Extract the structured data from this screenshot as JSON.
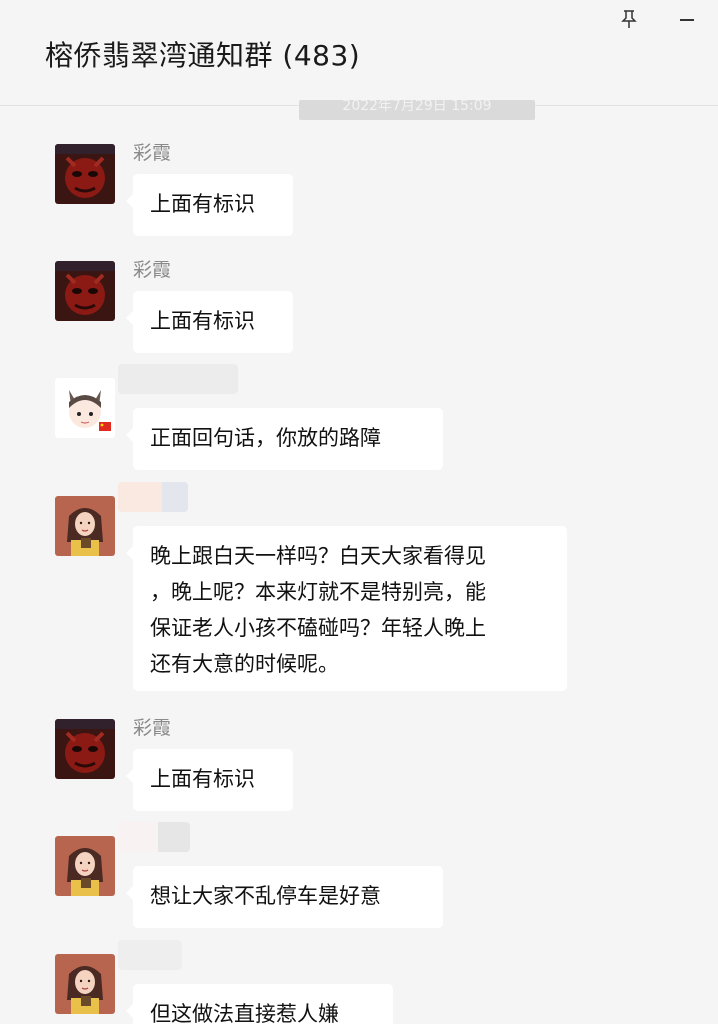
{
  "window": {
    "title": "榕侨翡翠湾通知群 (483)"
  },
  "timestamp": "2022年7月29日 15:09",
  "messages": [
    {
      "sender": "彩霞",
      "avatar": "red-mask-avatar",
      "text": "上面有标识"
    },
    {
      "sender": "彩霞",
      "avatar": "red-mask-avatar",
      "text": "上面有标识"
    },
    {
      "sender": "",
      "avatar": "cartoon-cat-avatar",
      "text": "正面回句话，你放的路障"
    },
    {
      "sender": "",
      "avatar": "woman-portrait-avatar",
      "text_lines": [
        "晚上跟白天一样吗？白天大家看得见",
        "，晚上呢？本来灯就不是特别亮，能",
        "保证老人小孩不磕碰吗？年轻人晚上",
        "还有大意的时候呢。"
      ]
    },
    {
      "sender": "彩霞",
      "avatar": "red-mask-avatar",
      "text": "上面有标识"
    },
    {
      "sender": "",
      "avatar": "woman-portrait-avatar",
      "text": "想让大家不乱停车是好意"
    },
    {
      "sender": "",
      "avatar": "woman-portrait-avatar",
      "text": "但这做法直接惹人嫌"
    }
  ],
  "colors": {
    "background": "#f5f5f5",
    "bubble": "#ffffff",
    "sender_name": "#8a8a8a"
  }
}
